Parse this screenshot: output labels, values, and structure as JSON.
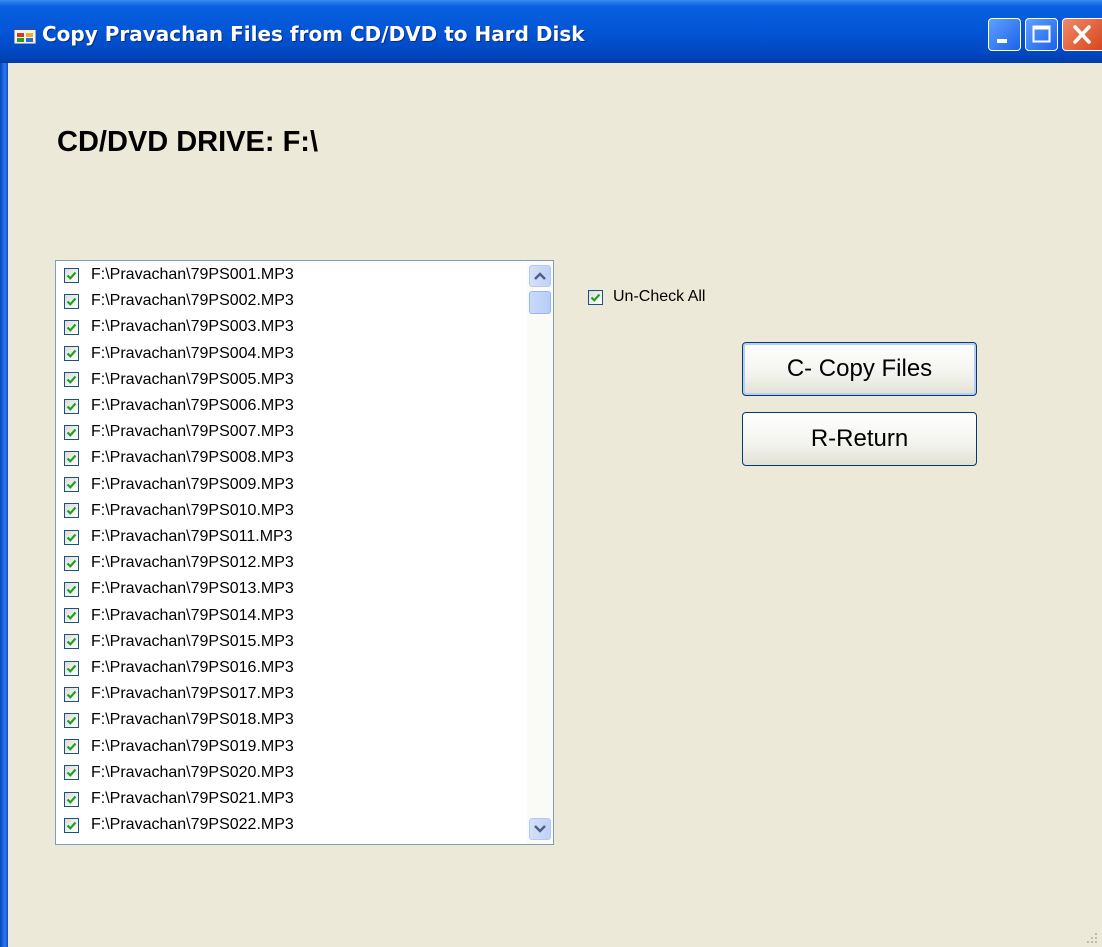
{
  "window": {
    "title": "Copy Pravachan Files from CD/DVD to Hard Disk",
    "icons": [
      "app-icon",
      "minimize-icon",
      "maximize-icon",
      "close-icon"
    ]
  },
  "drive": {
    "label": "CD/DVD DRIVE: F:\\"
  },
  "file_list": {
    "items": [
      {
        "label": "F:\\Pravachan\\79PS001.MP3",
        "checked": true
      },
      {
        "label": "F:\\Pravachan\\79PS002.MP3",
        "checked": true
      },
      {
        "label": "F:\\Pravachan\\79PS003.MP3",
        "checked": true
      },
      {
        "label": "F:\\Pravachan\\79PS004.MP3",
        "checked": true
      },
      {
        "label": "F:\\Pravachan\\79PS005.MP3",
        "checked": true
      },
      {
        "label": "F:\\Pravachan\\79PS006.MP3",
        "checked": true
      },
      {
        "label": "F:\\Pravachan\\79PS007.MP3",
        "checked": true
      },
      {
        "label": "F:\\Pravachan\\79PS008.MP3",
        "checked": true
      },
      {
        "label": "F:\\Pravachan\\79PS009.MP3",
        "checked": true
      },
      {
        "label": "F:\\Pravachan\\79PS010.MP3",
        "checked": true
      },
      {
        "label": "F:\\Pravachan\\79PS011.MP3",
        "checked": true
      },
      {
        "label": "F:\\Pravachan\\79PS012.MP3",
        "checked": true
      },
      {
        "label": "F:\\Pravachan\\79PS013.MP3",
        "checked": true
      },
      {
        "label": "F:\\Pravachan\\79PS014.MP3",
        "checked": true
      },
      {
        "label": "F:\\Pravachan\\79PS015.MP3",
        "checked": true
      },
      {
        "label": "F:\\Pravachan\\79PS016.MP3",
        "checked": true
      },
      {
        "label": "F:\\Pravachan\\79PS017.MP3",
        "checked": true
      },
      {
        "label": "F:\\Pravachan\\79PS018.MP3",
        "checked": true
      },
      {
        "label": "F:\\Pravachan\\79PS019.MP3",
        "checked": true
      },
      {
        "label": "F:\\Pravachan\\79PS020.MP3",
        "checked": true
      },
      {
        "label": "F:\\Pravachan\\79PS021.MP3",
        "checked": true
      },
      {
        "label": "F:\\Pravachan\\79PS022.MP3",
        "checked": true
      }
    ]
  },
  "uncheck_all": {
    "label": "Un-Check All",
    "checked": true
  },
  "buttons": {
    "copy_label": "C- Copy Files",
    "return_label": "R-Return"
  },
  "colors": {
    "titlebar": "#0256d6",
    "window_bg": "#ece9d8",
    "checkmark": "#21a121",
    "button_border": "#003c74"
  }
}
